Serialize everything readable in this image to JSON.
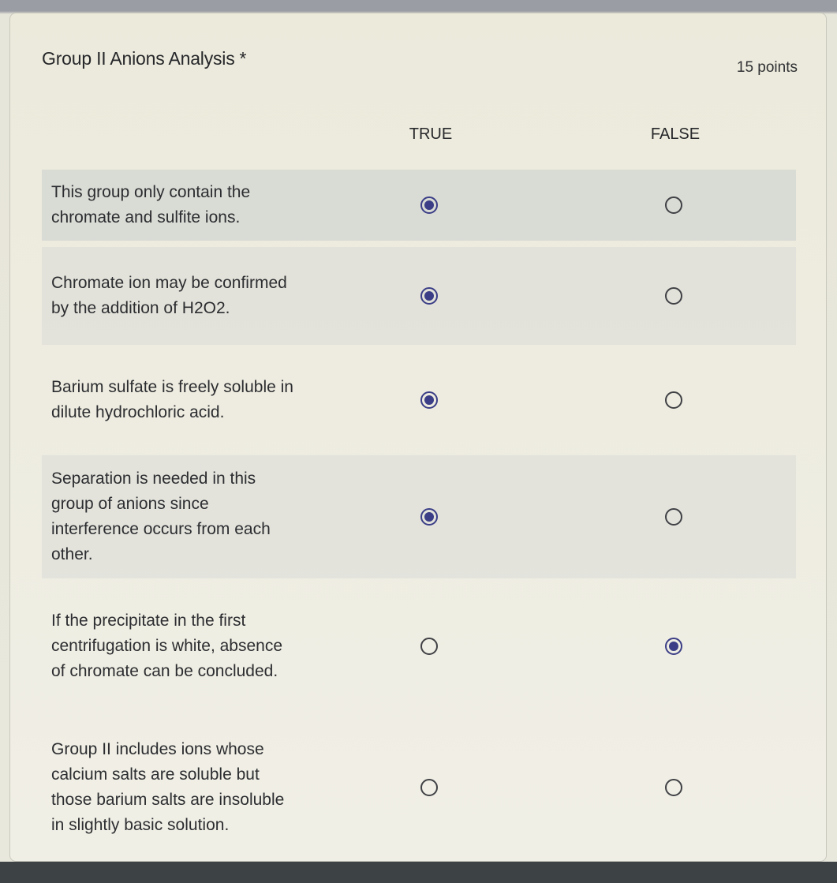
{
  "question": {
    "title": "Group II Anions Analysis",
    "required_mark": "*",
    "points": "15 points"
  },
  "columns": {
    "true_label": "TRUE",
    "false_label": "FALSE"
  },
  "rows": [
    {
      "label": "This group only contain the chromate and sulfite ions.",
      "selected": "TRUE"
    },
    {
      "label": "Chromate ion may be confirmed by the addition of H2O2.",
      "selected": "TRUE"
    },
    {
      "label": "Barium sulfate is freely soluble in dilute hydrochloric acid.",
      "selected": "TRUE"
    },
    {
      "label": "Separation is needed in this group of anions since interference occurs from each other.",
      "selected": "TRUE"
    },
    {
      "label": "If the precipitate in the first centrifugation is white, absence of chromate can be concluded.",
      "selected": "FALSE"
    },
    {
      "label": "Group II includes ions whose calcium salts are soluble but those barium salts are insoluble in slightly basic solution.",
      "selected": null
    }
  ],
  "colors": {
    "accent": "#3b3e86"
  }
}
